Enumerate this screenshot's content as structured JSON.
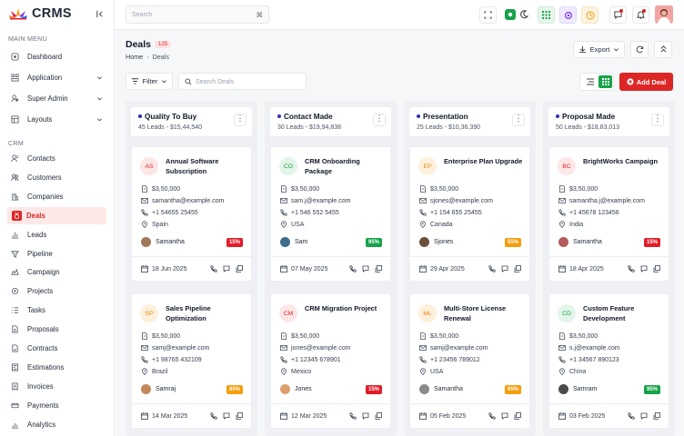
{
  "app": {
    "name": "CRMS"
  },
  "header": {
    "search_placeholder": "Search",
    "shortcut": "⌘"
  },
  "sidebar": {
    "main_label": "MAIN MENU",
    "main": [
      {
        "label": "Dashboard",
        "icon": "dashboard-icon"
      },
      {
        "label": "Application",
        "icon": "apps-icon",
        "chevron": true
      },
      {
        "label": "Super Admin",
        "icon": "user-shield-icon",
        "chevron": true
      },
      {
        "label": "Layouts",
        "icon": "layout-icon",
        "chevron": true
      }
    ],
    "crm_label": "CRM",
    "crm": [
      {
        "label": "Contacts",
        "icon": "contacts-icon"
      },
      {
        "label": "Customers",
        "icon": "users-icon"
      },
      {
        "label": "Companies",
        "icon": "building-icon"
      },
      {
        "label": "Deals",
        "icon": "medal-icon",
        "active": true
      },
      {
        "label": "Leads",
        "icon": "chart-icon"
      },
      {
        "label": "Pipeline",
        "icon": "pipeline-icon"
      },
      {
        "label": "Campaign",
        "icon": "campaign-icon"
      },
      {
        "label": "Projects",
        "icon": "projects-icon"
      },
      {
        "label": "Tasks",
        "icon": "tasks-icon"
      },
      {
        "label": "Proposals",
        "icon": "proposal-icon"
      },
      {
        "label": "Contracts",
        "icon": "contract-icon"
      },
      {
        "label": "Estimations",
        "icon": "estimation-icon"
      },
      {
        "label": "Invoices",
        "icon": "invoice-icon"
      },
      {
        "label": "Payments",
        "icon": "payment-icon"
      },
      {
        "label": "Analytics",
        "icon": "analytics-icon"
      }
    ]
  },
  "page": {
    "title": "Deals",
    "count": "125",
    "crumb_home": "Home",
    "crumb_current": "Deals",
    "export_label": "Export",
    "filter_label": "Filter",
    "search_placeholder": "Search Deals",
    "add_label": "Add Deal"
  },
  "columns": [
    {
      "name": "Quality To Buy",
      "summary": "45 Leads - $15,44,540",
      "cards": [
        {
          "initials": "AS",
          "title": "Annual Software Subscription",
          "amount": "$3,50,000",
          "email": "samantha@example.com",
          "phone": "+1 54655 25455",
          "country": "Spain",
          "owner": "Samantha",
          "percent": "15%",
          "date": "18 Jun 2025",
          "tone": "red"
        },
        {
          "initials": "SP",
          "title": "Sales Pipeline Optimization",
          "amount": "$3,50,000",
          "email": "samj@example.com",
          "phone": "+1 98765 432109",
          "country": "Brazil",
          "owner": "Samraj",
          "percent": "65%",
          "date": "14 Mar 2025",
          "tone": "orange"
        }
      ]
    },
    {
      "name": "Contact Made",
      "summary": "30 Leads - $19,94,838",
      "cards": [
        {
          "initials": "CO",
          "title": "CRM Onboarding Package",
          "amount": "$3,50,000",
          "email": "sam.j@example.com",
          "phone": "+1 546 552 5455",
          "country": "USA",
          "owner": "Sam",
          "percent": "95%",
          "date": "07 May 2025",
          "tone": "green"
        },
        {
          "initials": "CM",
          "title": "CRM Migration Project",
          "amount": "$3,50,000",
          "email": "jones@example.com",
          "phone": "+1 12345 678901",
          "country": "Mexico",
          "owner": "Jones",
          "percent": "15%",
          "date": "12 Mar 2025",
          "tone": "red"
        }
      ]
    },
    {
      "name": "Presentation",
      "summary": "25 Leads - $10,36,390",
      "cards": [
        {
          "initials": "EP",
          "title": "Enterprise Plan Upgrade",
          "amount": "$3,50,000",
          "email": "sjones@example.com",
          "phone": "+1 154 655 25455",
          "country": "Canada",
          "owner": "Sjones",
          "percent": "55%",
          "date": "29 Apr 2025",
          "tone": "orange"
        },
        {
          "initials": "ML",
          "title": "Multi-Store License Renewal",
          "amount": "$3,50,000",
          "email": "samj@example.com",
          "phone": "+1 23456 789012",
          "country": "USA",
          "owner": "Samantha",
          "percent": "65%",
          "date": "05 Feb 2025",
          "tone": "orange"
        }
      ]
    },
    {
      "name": "Proposal Made",
      "summary": "50 Leads - $18,83,013",
      "cards": [
        {
          "initials": "BC",
          "title": "BrightWorks Campaign",
          "amount": "$3,50,000",
          "email": "samantha.j@example.com",
          "phone": "+1 45678 123456",
          "country": "India",
          "owner": "Samantha",
          "percent": "15%",
          "date": "18 Apr 2025",
          "tone": "red"
        },
        {
          "initials": "CD",
          "title": "Custom Feature Development",
          "amount": "$3,50,000",
          "email": "s.j@example.com",
          "phone": "+1 34567 890123",
          "country": "China",
          "owner": "Samram",
          "percent": "95%",
          "date": "03 Feb 2025",
          "tone": "green"
        }
      ]
    }
  ],
  "colors": {
    "accent": "#dc2626",
    "red": "#e11d2a",
    "orange": "#f59e0b",
    "green": "#16a34a"
  }
}
